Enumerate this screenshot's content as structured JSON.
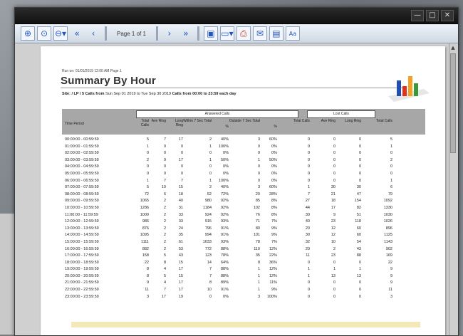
{
  "window": {
    "controls": [
      "—",
      "□",
      "✕"
    ],
    "toolbar": {
      "page_indicator": "Page 1 of 1",
      "icons": [
        "zoom-in-icon",
        "zoom-fit-icon",
        "zoom-out-icon",
        "first-page-icon",
        "prev-page-icon",
        "next-page-icon",
        "last-page-icon",
        "export-icon",
        "page-setup-icon",
        "print-icon",
        "email-icon",
        "settings-icon",
        "text-icon"
      ]
    }
  },
  "report": {
    "meta": "Run on: 01/01/2019 12:00 AM    Page 1",
    "title": "Summary By Hour",
    "filter_prefix": "Site: / LP / 5",
    "filter_calls_from": "Calls from",
    "filter_date_range": "Sun Sep 01 2019 to Tue Sep 30 2019",
    "filter_time_from": "Calls from 00:00 to 23:59 each day",
    "groups": {
      "answered": "Answered Calls",
      "lost": "Lost Calls"
    },
    "columns": [
      "Time Period",
      "Total Calls",
      "Ave Ring",
      "Long Ring",
      "Within 7 Sec Total",
      "%",
      "Outside 7 Sec Total",
      "%",
      "Total Calls",
      "Ave Ring",
      "Long Ring",
      "Total Calls"
    ],
    "rows": [
      [
        "00:00:00 - 00:59:59",
        "5",
        "7",
        "17",
        "2",
        "40%",
        "3",
        "60%",
        "0",
        "0",
        "0",
        "5"
      ],
      [
        "01:00:00 - 01:59:59",
        "1",
        "0",
        "0",
        "1",
        "100%",
        "0",
        "0%",
        "0",
        "0",
        "0",
        "1"
      ],
      [
        "02:00:00 - 02:59:59",
        "0",
        "0",
        "0",
        "0",
        "0%",
        "0",
        "0%",
        "0",
        "0",
        "0",
        "0"
      ],
      [
        "03:00:00 - 03:59:59",
        "2",
        "9",
        "17",
        "1",
        "50%",
        "1",
        "50%",
        "0",
        "0",
        "0",
        "2"
      ],
      [
        "04:00:00 - 04:59:59",
        "0",
        "0",
        "0",
        "0",
        "0%",
        "0",
        "0%",
        "0",
        "0",
        "0",
        "0"
      ],
      [
        "05:00:00 - 05:59:59",
        "0",
        "0",
        "0",
        "0",
        "0%",
        "0",
        "0%",
        "0",
        "0",
        "0",
        "0"
      ],
      [
        "06:00:00 - 06:59:59",
        "1",
        "7",
        "7",
        "1",
        "100%",
        "0",
        "0%",
        "0",
        "0",
        "0",
        "1"
      ],
      [
        "07:00:00 - 07:59:59",
        "5",
        "10",
        "15",
        "2",
        "40%",
        "3",
        "60%",
        "1",
        "30",
        "30",
        "6"
      ],
      [
        "08:00:00 - 08:59:59",
        "72",
        "6",
        "18",
        "52",
        "72%",
        "20",
        "28%",
        "7",
        "21",
        "47",
        "79"
      ],
      [
        "09:00:00 - 09:59:59",
        "1065",
        "2",
        "40",
        "980",
        "92%",
        "85",
        "8%",
        "27",
        "18",
        "154",
        "1092"
      ],
      [
        "10:00:00 - 10:59:59",
        "1286",
        "2",
        "31",
        "1184",
        "92%",
        "102",
        "8%",
        "44",
        "17",
        "82",
        "1330"
      ],
      [
        "11:00:00 - 11:59:59",
        "1000",
        "2",
        "33",
        "924",
        "92%",
        "76",
        "8%",
        "30",
        "9",
        "51",
        "1030"
      ],
      [
        "12:00:00 - 12:59:59",
        "986",
        "2",
        "33",
        "915",
        "93%",
        "71",
        "7%",
        "40",
        "23",
        "118",
        "1026"
      ],
      [
        "13:00:00 - 13:59:59",
        "876",
        "2",
        "24",
        "796",
        "91%",
        "80",
        "9%",
        "20",
        "12",
        "60",
        "896"
      ],
      [
        "14:00:00 - 14:59:59",
        "1095",
        "2",
        "35",
        "994",
        "91%",
        "101",
        "9%",
        "30",
        "12",
        "60",
        "1125"
      ],
      [
        "15:00:00 - 15:59:59",
        "1111",
        "2",
        "61",
        "1033",
        "93%",
        "78",
        "7%",
        "32",
        "10",
        "54",
        "1143"
      ],
      [
        "16:00:00 - 16:59:59",
        "882",
        "2",
        "53",
        "772",
        "88%",
        "110",
        "12%",
        "20",
        "2",
        "43",
        "902"
      ],
      [
        "17:00:00 - 17:59:59",
        "158",
        "5",
        "43",
        "123",
        "78%",
        "35",
        "22%",
        "11",
        "23",
        "88",
        "169"
      ],
      [
        "18:00:00 - 18:59:59",
        "22",
        "8",
        "15",
        "14",
        "64%",
        "8",
        "36%",
        "0",
        "0",
        "0",
        "22"
      ],
      [
        "19:00:00 - 19:59:59",
        "8",
        "4",
        "17",
        "7",
        "88%",
        "1",
        "12%",
        "1",
        "1",
        "1",
        "9"
      ],
      [
        "20:00:00 - 20:59:59",
        "8",
        "5",
        "15",
        "7",
        "88%",
        "1",
        "12%",
        "1",
        "13",
        "13",
        "9"
      ],
      [
        "21:00:00 - 21:59:59",
        "9",
        "4",
        "17",
        "8",
        "89%",
        "1",
        "11%",
        "0",
        "0",
        "0",
        "9"
      ],
      [
        "22:00:00 - 22:59:59",
        "11",
        "7",
        "17",
        "10",
        "91%",
        "1",
        "9%",
        "0",
        "0",
        "0",
        "11"
      ],
      [
        "23:00:00 - 23:59:59",
        "3",
        "17",
        "19",
        "0",
        "0%",
        "3",
        "100%",
        "0",
        "0",
        "0",
        "3"
      ]
    ]
  },
  "colors": {
    "header_gray": "#a7a7a7",
    "toolbar_blue": "#1f56c7",
    "logo_bars": [
      "#1f4fb5",
      "#e03020",
      "#f4a020",
      "#3a9a3a"
    ]
  }
}
